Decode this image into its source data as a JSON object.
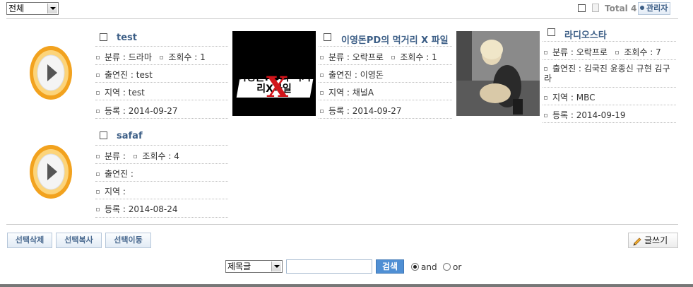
{
  "filter": {
    "selected": "전체"
  },
  "header": {
    "total_label": "Total",
    "total_count": "4",
    "admin_label": "관리자"
  },
  "items": [
    {
      "title": "test",
      "category_label": "분류 : 드라마",
      "views_label": "조회수 : 1",
      "cast_label": "출연진 : test",
      "region_label": "지역 : test",
      "date_label": "등록 : 2014-09-27",
      "thumbnail": "play-icon"
    },
    {
      "title": "이영돈PD의 먹거리 X 파일",
      "category_label": "분류 : 오락프로",
      "views_label": "조회수 : 1",
      "cast_label": "출연진 : 이영돈",
      "region_label": "지역 : 채널A",
      "date_label": "등록 : 2014-09-27",
      "thumbnail": "show-logo-image",
      "thumbnail_text": "이영돈PD의 먹거리X파일"
    },
    {
      "title": "라디오스타",
      "category_label": "분류 : 오락프로",
      "views_label": "조회수 : 7",
      "cast_label": "출연진 : 김국진 윤종신 규현 김구라",
      "region_label": "지역 : MBC",
      "date_label": "등록 : 2014-09-19",
      "thumbnail": "photo-woman"
    },
    {
      "title": "safaf",
      "category_label": "분류 :",
      "views_label": "조회수 : 4",
      "cast_label": "출연진 :",
      "region_label": "지역 :",
      "date_label": "등록 : 2014-08-24",
      "thumbnail": "play-icon"
    }
  ],
  "actions": {
    "delete_label": "선택삭제",
    "copy_label": "선택복사",
    "move_label": "선택이동",
    "write_label": "글쓰기"
  },
  "search": {
    "field_selected": "제목글",
    "query": "",
    "button_label": "검색",
    "and_label": "and",
    "or_label": "or",
    "mode": "and"
  },
  "colors": {
    "title": "#3c5e86",
    "search_button": "#4f8fd4"
  }
}
